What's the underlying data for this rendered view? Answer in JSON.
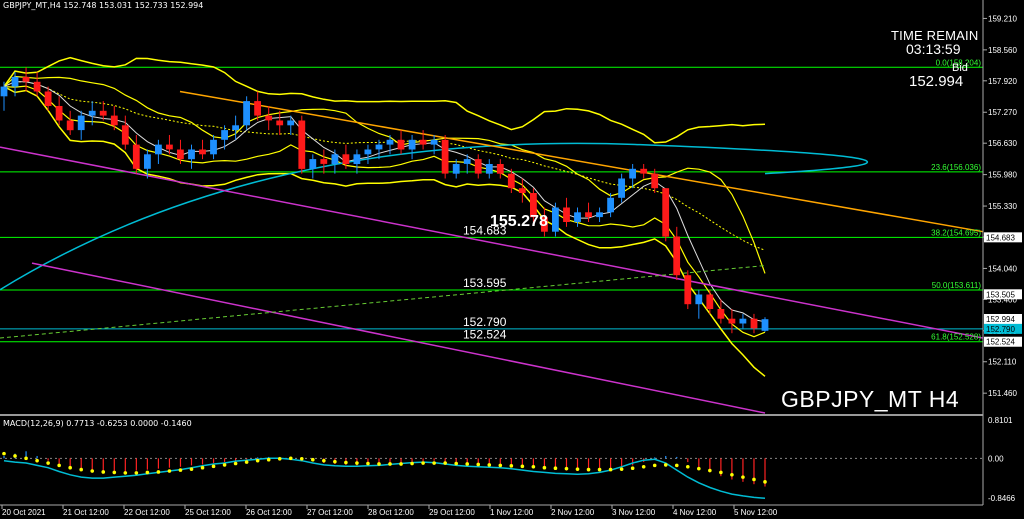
{
  "window": {
    "symbol": "GBPJPY_MT,H4",
    "ohlc": "152.748 153.031 152.733 152.994",
    "time_remain_label": "TIME REMAIN",
    "time_remain": "03:13:59",
    "bid_label": "Bid",
    "bid_value": "152.994",
    "watermark": "GBPJPY_MT H4",
    "macd_label": "MACD(12,26,9) 0.7713 -0.6253 0.0000 -0.1460"
  },
  "colors": {
    "background": "#000000",
    "bull": "#1e90ff",
    "bear": "#ff1a1a",
    "level_line": "#00ff00",
    "fib_text": "#33ff33",
    "bollinger": "#ffff00",
    "channel": "#cc33cc",
    "trend": "#ffa500",
    "ma_long": "#00bcd4",
    "ma_short": "#dddddd",
    "macd_hist": "#ff2222",
    "macd_signal": "#ffff00",
    "macd_line": "#00bcd4",
    "price_tag_bg": "#ffffff",
    "bid_tag_bg": "#00bcd4"
  },
  "chart_data": [
    {
      "type": "candlestick",
      "title": "GBPJPY_MT,H4",
      "ylim": [
        151.05,
        159.55
      ],
      "price_axis_ticks": [
        "159.210",
        "158.560",
        "157.920",
        "157.270",
        "156.630",
        "155.980",
        "155.330",
        "154.690",
        "154.040",
        "153.400",
        "152.750",
        "152.110",
        "151.460"
      ],
      "x_tick_labels": [
        "20 Oct 2021",
        "21 Oct 12:00",
        "22 Oct 12:00",
        "25 Oct 12:00",
        "26 Oct 12:00",
        "27 Oct 12:00",
        "28 Oct 12:00",
        "29 Oct 12:00",
        "1 Nov 12:00",
        "2 Nov 12:00",
        "3 Nov 12:00",
        "4 Nov 12:00",
        "5 Nov 12:00"
      ],
      "candles_ohlc": [
        [
          157.6,
          157.9,
          157.3,
          157.8
        ],
        [
          157.8,
          158.1,
          157.6,
          158.0
        ],
        [
          158.0,
          158.2,
          157.7,
          157.9
        ],
        [
          157.9,
          158.1,
          157.6,
          157.7
        ],
        [
          157.7,
          157.8,
          157.3,
          157.4
        ],
        [
          157.4,
          157.6,
          157.0,
          157.1
        ],
        [
          157.1,
          157.3,
          156.8,
          156.9
        ],
        [
          156.9,
          157.3,
          156.7,
          157.2
        ],
        [
          157.2,
          157.5,
          157.0,
          157.3
        ],
        [
          157.3,
          157.5,
          157.1,
          157.2
        ],
        [
          157.2,
          157.4,
          156.9,
          157.0
        ],
        [
          157.0,
          157.2,
          156.5,
          156.6
        ],
        [
          156.6,
          156.8,
          156.0,
          156.1
        ],
        [
          156.1,
          156.5,
          155.9,
          156.4
        ],
        [
          156.4,
          156.7,
          156.2,
          156.6
        ],
        [
          156.6,
          156.8,
          156.4,
          156.5
        ],
        [
          156.5,
          156.7,
          156.2,
          156.3
        ],
        [
          156.3,
          156.6,
          156.1,
          156.5
        ],
        [
          156.5,
          156.7,
          156.3,
          156.4
        ],
        [
          156.4,
          156.8,
          156.3,
          156.7
        ],
        [
          156.7,
          157.0,
          156.5,
          156.9
        ],
        [
          156.9,
          157.2,
          156.7,
          157.0
        ],
        [
          157.0,
          157.6,
          156.9,
          157.5
        ],
        [
          157.5,
          157.7,
          157.1,
          157.2
        ],
        [
          157.2,
          157.4,
          156.9,
          157.1
        ],
        [
          157.1,
          157.3,
          156.8,
          157.0
        ],
        [
          157.0,
          157.2,
          156.8,
          157.1
        ],
        [
          157.1,
          157.2,
          156.0,
          156.1
        ],
        [
          156.1,
          156.4,
          155.9,
          156.3
        ],
        [
          156.3,
          156.5,
          156.0,
          156.2
        ],
        [
          156.2,
          156.5,
          156.0,
          156.4
        ],
        [
          156.4,
          156.6,
          156.1,
          156.2
        ],
        [
          156.2,
          156.5,
          156.0,
          156.4
        ],
        [
          156.4,
          156.6,
          156.2,
          156.5
        ],
        [
          156.5,
          156.7,
          156.3,
          156.6
        ],
        [
          156.6,
          156.8,
          156.4,
          156.7
        ],
        [
          156.7,
          156.9,
          156.4,
          156.5
        ],
        [
          156.5,
          156.8,
          156.3,
          156.7
        ],
        [
          156.7,
          156.9,
          156.5,
          156.6
        ],
        [
          156.6,
          156.8,
          156.4,
          156.7
        ],
        [
          156.7,
          156.8,
          155.9,
          156.0
        ],
        [
          156.0,
          156.3,
          155.9,
          156.2
        ],
        [
          156.2,
          156.4,
          156.0,
          156.3
        ],
        [
          156.3,
          156.4,
          155.9,
          156.0
        ],
        [
          156.0,
          156.3,
          155.9,
          156.2
        ],
        [
          156.2,
          156.3,
          155.9,
          156.0
        ],
        [
          156.0,
          156.1,
          155.6,
          155.7
        ],
        [
          155.7,
          155.9,
          155.4,
          155.6
        ],
        [
          155.6,
          155.7,
          155.0,
          155.1
        ],
        [
          155.1,
          155.3,
          154.7,
          154.8
        ],
        [
          154.8,
          155.4,
          154.7,
          155.3
        ],
        [
          155.3,
          155.5,
          154.9,
          155.0
        ],
        [
          155.0,
          155.3,
          154.9,
          155.2
        ],
        [
          155.2,
          155.4,
          155.0,
          155.1
        ],
        [
          155.1,
          155.3,
          155.0,
          155.2
        ],
        [
          155.2,
          155.6,
          155.1,
          155.5
        ],
        [
          155.5,
          156.0,
          155.4,
          155.9
        ],
        [
          155.9,
          156.2,
          155.7,
          156.1
        ],
        [
          156.1,
          156.2,
          155.9,
          156.0
        ],
        [
          156.0,
          156.1,
          155.6,
          155.7
        ],
        [
          155.7,
          155.7,
          154.6,
          154.7
        ],
        [
          154.7,
          154.9,
          153.8,
          153.9
        ],
        [
          153.9,
          154.0,
          153.2,
          153.3
        ],
        [
          153.3,
          153.6,
          153.0,
          153.5
        ],
        [
          153.5,
          153.6,
          153.1,
          153.2
        ],
        [
          153.2,
          153.4,
          152.9,
          153.0
        ],
        [
          153.0,
          153.2,
          152.7,
          152.9
        ],
        [
          152.9,
          153.1,
          152.8,
          153.0
        ],
        [
          153.0,
          153.1,
          152.7,
          152.8
        ],
        [
          152.75,
          153.03,
          152.73,
          152.99
        ]
      ],
      "horizontal_levels": [
        {
          "value": 158.2,
          "label": "0.0(158.204)"
        },
        {
          "value": 156.036,
          "label": "23.6(156.036)"
        },
        {
          "value": 154.683,
          "label": "154.683",
          "tag": "38.2(154.695)"
        },
        {
          "value": 153.595,
          "label": "153.595",
          "tag": "50.0(153.611)"
        },
        {
          "value": 152.79,
          "label": "152.790"
        },
        {
          "value": 152.524,
          "label": "152.524",
          "tag": "61.8(152.528)"
        }
      ],
      "price_tags": [
        {
          "value": 154.683,
          "text": "154.683"
        },
        {
          "value": 153.505,
          "text": "153.505"
        },
        {
          "value": 152.994,
          "text": "152.994"
        },
        {
          "value": 152.79,
          "text": "152.790"
        },
        {
          "value": 152.524,
          "text": "152.524"
        }
      ],
      "highlight_label": {
        "value": 155.0,
        "text": "155.278"
      }
    },
    {
      "type": "bar",
      "title": "MACD(12,26,9)",
      "ylim": [
        -0.95,
        0.9
      ],
      "axis_ticks": [
        "0.8101",
        "0.00",
        "-0.8466"
      ],
      "histogram": [
        0.05,
        0.1,
        0.15,
        0.05,
        -0.05,
        -0.12,
        -0.18,
        -0.22,
        -0.25,
        -0.27,
        -0.28,
        -0.28,
        -0.26,
        -0.24,
        -0.22,
        -0.2,
        -0.18,
        -0.15,
        -0.13,
        -0.1,
        -0.08,
        -0.05,
        -0.02,
        0.02,
        0.03,
        0.03,
        0.02,
        -0.02,
        -0.06,
        -0.1,
        -0.12,
        -0.14,
        -0.15,
        -0.15,
        -0.14,
        -0.12,
        -0.1,
        -0.08,
        -0.06,
        -0.05,
        -0.08,
        -0.1,
        -0.12,
        -0.14,
        -0.15,
        -0.15,
        -0.16,
        -0.18,
        -0.2,
        -0.22,
        -0.24,
        -0.26,
        -0.27,
        -0.28,
        -0.28,
        -0.26,
        -0.22,
        -0.15,
        -0.08,
        0.02,
        0.05,
        0.03,
        -0.08,
        -0.2,
        -0.3,
        -0.38,
        -0.45,
        -0.5,
        -0.55,
        -0.6
      ],
      "macd_line": [
        -0.05,
        -0.08,
        -0.1,
        -0.15,
        -0.2,
        -0.28,
        -0.35,
        -0.4,
        -0.42,
        -0.42,
        -0.4,
        -0.38,
        -0.36,
        -0.33,
        -0.3,
        -0.27,
        -0.24,
        -0.2,
        -0.16,
        -0.12,
        -0.1,
        -0.06,
        -0.04,
        -0.02,
        0.0,
        0.0,
        -0.02,
        -0.05,
        -0.1,
        -0.14,
        -0.16,
        -0.17,
        -0.17,
        -0.16,
        -0.15,
        -0.13,
        -0.11,
        -0.09,
        -0.08,
        -0.09,
        -0.12,
        -0.15,
        -0.17,
        -0.18,
        -0.19,
        -0.2,
        -0.22,
        -0.25,
        -0.28,
        -0.3,
        -0.32,
        -0.33,
        -0.34,
        -0.33,
        -0.3,
        -0.25,
        -0.18,
        -0.1,
        -0.04,
        -0.02,
        -0.1,
        -0.25,
        -0.4,
        -0.52,
        -0.62,
        -0.7,
        -0.76,
        -0.8,
        -0.83,
        -0.85
      ],
      "signal_line": [
        0.1,
        0.05,
        0.0,
        -0.05,
        -0.1,
        -0.15,
        -0.2,
        -0.24,
        -0.27,
        -0.29,
        -0.3,
        -0.31,
        -0.31,
        -0.3,
        -0.29,
        -0.27,
        -0.25,
        -0.23,
        -0.2,
        -0.17,
        -0.14,
        -0.11,
        -0.08,
        -0.05,
        -0.03,
        -0.01,
        0.0,
        -0.01,
        -0.03,
        -0.05,
        -0.07,
        -0.09,
        -0.1,
        -0.11,
        -0.12,
        -0.12,
        -0.12,
        -0.11,
        -0.1,
        -0.1,
        -0.1,
        -0.11,
        -0.12,
        -0.13,
        -0.14,
        -0.15,
        -0.16,
        -0.17,
        -0.18,
        -0.2,
        -0.21,
        -0.22,
        -0.23,
        -0.24,
        -0.24,
        -0.24,
        -0.23,
        -0.21,
        -0.18,
        -0.15,
        -0.14,
        -0.15,
        -0.18,
        -0.22,
        -0.26,
        -0.3,
        -0.35,
        -0.4,
        -0.45,
        -0.5
      ]
    }
  ]
}
